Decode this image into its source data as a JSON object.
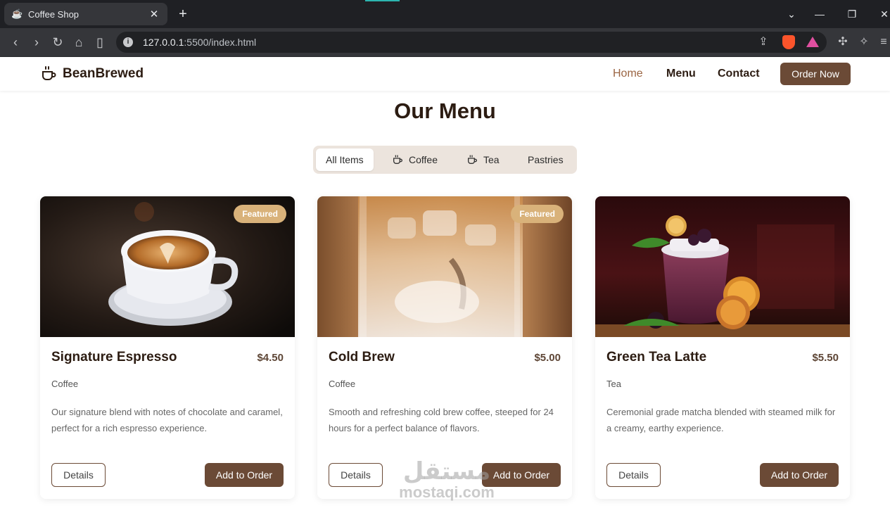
{
  "browser": {
    "tab_title": "Coffee Shop",
    "url_host": "127.0.0.1",
    "url_rest": ":5500/index.html"
  },
  "site": {
    "brand": "BeanBrewed",
    "nav": [
      {
        "label": "Home",
        "active": true
      },
      {
        "label": "Menu",
        "active": false
      },
      {
        "label": "Contact",
        "active": false
      }
    ],
    "order_button": "Order Now",
    "title": "Our Menu",
    "filters": [
      {
        "label": "All Items",
        "active": true,
        "icon": "none"
      },
      {
        "label": "Coffee",
        "active": false,
        "icon": "cup-icon"
      },
      {
        "label": "Tea",
        "active": false,
        "icon": "cup-icon"
      },
      {
        "label": "Pastries",
        "active": false,
        "icon": "none"
      }
    ],
    "items": [
      {
        "name": "Signature Espresso",
        "price": "$4.50",
        "category": "Coffee",
        "badge": "Featured",
        "description": "Our signature blend with notes of chocolate and caramel, perfect for a rich espresso experience.",
        "details_label": "Details",
        "add_label": "Add to Order"
      },
      {
        "name": "Cold Brew",
        "price": "$5.00",
        "category": "Coffee",
        "badge": "Featured",
        "description": "Smooth and refreshing cold brew coffee, steeped for 24 hours for a perfect balance of flavors.",
        "details_label": "Details",
        "add_label": "Add to Order"
      },
      {
        "name": "Green Tea Latte",
        "price": "$5.50",
        "category": "Tea",
        "badge": "",
        "description": "Ceremonial grade matcha blended with steamed milk for a creamy, earthy experience.",
        "details_label": "Details",
        "add_label": "Add to Order"
      }
    ]
  },
  "watermark": {
    "arabic": "مستقل",
    "latin": "mostaqi.com"
  },
  "colors": {
    "brand_brown": "#6b4a36",
    "accent_active": "#9b6543",
    "badge": "#d9b27a"
  }
}
